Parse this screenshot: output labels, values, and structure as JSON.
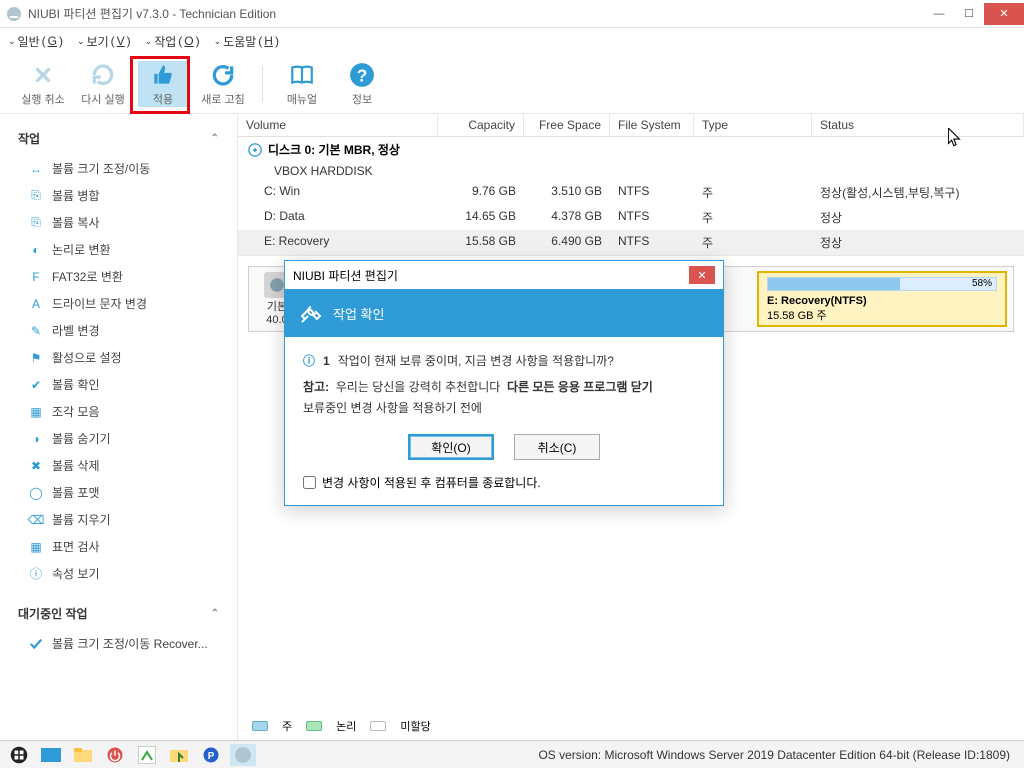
{
  "window": {
    "title": "NIUBI 파티션 편집기 v7.3.0 - Technician Edition"
  },
  "menu": {
    "general": "일반",
    "general_key": "G",
    "view": "보기",
    "view_key": "V",
    "task": "작업",
    "task_key": "O",
    "help": "도움말",
    "help_key": "H"
  },
  "toolbar": {
    "undo": "실행 취소",
    "redo": "다시 실행",
    "apply": "적용",
    "refresh": "새로 고침",
    "manual": "매뉴얼",
    "info": "정보"
  },
  "sidebar": {
    "tasks_header": "작업",
    "items": [
      "볼륨 크기 조정/이동",
      "볼륨 병합",
      "볼륨 복사",
      "논리로 변환",
      "FAT32로 변환",
      "드라이브 문자 변경",
      "라벨 변경",
      "활성으로 설정",
      "볼륨 확인",
      "조각 모음",
      "볼륨 숨기기",
      "볼륨 삭제",
      "볼륨 포맷",
      "볼륨 지우기",
      "표면 검사",
      "속성 보기"
    ],
    "pending_header": "대기중인 작업",
    "pending_item": "볼륨 크기 조정/이동 Recover..."
  },
  "table": {
    "headers": {
      "volume": "Volume",
      "capacity": "Capacity",
      "free": "Free Space",
      "fs": "File System",
      "type": "Type",
      "status": "Status"
    },
    "disk": {
      "label": "디스크 0: 기본 MBR, 정상",
      "model": "VBOX HARDDISK"
    },
    "rows": [
      {
        "vol": "C: Win",
        "cap": "9.76 GB",
        "free": "3.510 GB",
        "fs": "NTFS",
        "type": "주",
        "status": "정상(활성,시스템,부팅,복구)"
      },
      {
        "vol": "D: Data",
        "cap": "14.65 GB",
        "free": "4.378 GB",
        "fs": "NTFS",
        "type": "주",
        "status": "정상"
      },
      {
        "vol": "E: Recovery",
        "cap": "15.58 GB",
        "free": "6.490 GB",
        "fs": "NTFS",
        "type": "주",
        "status": "정상"
      }
    ]
  },
  "diskmap": {
    "disk_label": "기본 ",
    "disk_size": "40.0",
    "sel_name": "E: Recovery(NTFS)",
    "sel_size": "15.58 GB 주",
    "sel_pct": "58%"
  },
  "legend": {
    "primary": "주",
    "logical": "논리",
    "unalloc": "미할당"
  },
  "dialog": {
    "title": "NIUBI 파티션 편집기",
    "banner": "작업 확인",
    "count": "1",
    "question": "작업이 현재 보류 중이며, 지금 변경 사항을 적용합니까?",
    "note_label": "참고:",
    "note_text1": "우리는 당신을 강력히 추천합니다",
    "note_bold": "다른 모든 응용 프로그램 닫기",
    "note_text2": "보류중인 변경 사항을 적용하기 전에",
    "ok": "확인(O)",
    "cancel": "취소(C)",
    "checkbox": "변경 사항이 적용된 후 컴퓨터를 종료합니다."
  },
  "status": {
    "text": "OS version: Microsoft Windows Server 2019 Datacenter Edition  64-bit  (Release ID:1809)"
  },
  "colors": {
    "accent": "#2e9bd6",
    "highlight_border": "#e30613",
    "sel_bg": "#fff3c1"
  }
}
